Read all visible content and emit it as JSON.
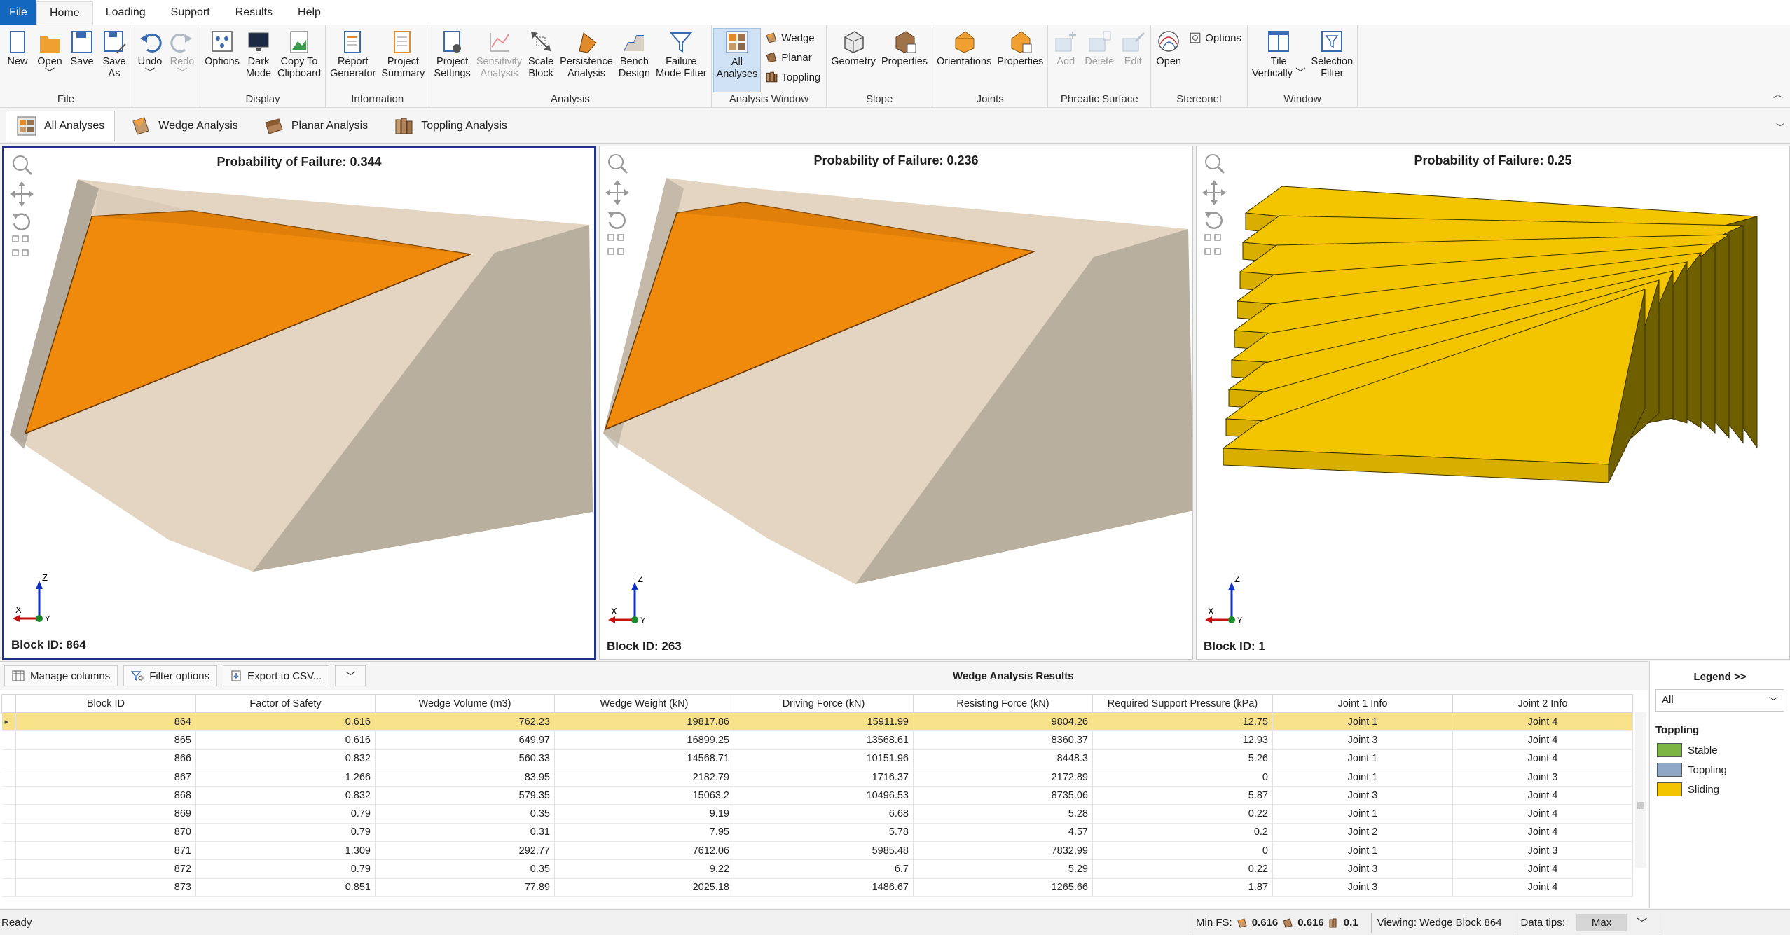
{
  "menu": [
    "File",
    "Home",
    "Loading",
    "Support",
    "Results",
    "Help"
  ],
  "ribbon": {
    "groups": [
      {
        "label": "File",
        "buttons": [
          {
            "label": "New",
            "icon": "new-file-icon"
          },
          {
            "label": "Open\n﹀",
            "icon": "open-folder-icon"
          },
          {
            "label": "Save",
            "icon": "save-icon"
          },
          {
            "label": "Save\nAs",
            "icon": "save-as-icon"
          }
        ]
      },
      {
        "label": "",
        "buttons": [
          {
            "label": "Undo\n﹀",
            "icon": "undo-icon"
          },
          {
            "label": "Redo\n﹀",
            "icon": "redo-icon",
            "disabled": true
          }
        ]
      },
      {
        "label": "Display",
        "buttons": [
          {
            "label": "Options",
            "icon": "options-icon"
          },
          {
            "label": "Dark\nMode",
            "icon": "dark-mode-icon"
          },
          {
            "label": "Copy To\nClipboard",
            "icon": "clipboard-icon"
          }
        ]
      },
      {
        "label": "Information",
        "buttons": [
          {
            "label": "Report\nGenerator",
            "icon": "report-icon"
          },
          {
            "label": "Project\nSummary",
            "icon": "summary-icon"
          }
        ]
      },
      {
        "label": "Analysis",
        "buttons": [
          {
            "label": "Project\nSettings",
            "icon": "settings-icon"
          },
          {
            "label": "Sensitivity\nAnalysis",
            "icon": "sensitivity-icon",
            "disabled": true
          },
          {
            "label": "Scale\nBlock",
            "icon": "scale-block-icon"
          },
          {
            "label": "Persistence\nAnalysis",
            "icon": "persistence-icon"
          },
          {
            "label": "Bench\nDesign",
            "icon": "bench-icon"
          },
          {
            "label": "Failure\nMode Filter",
            "icon": "filter-icon"
          }
        ]
      },
      {
        "label": "Analysis Window",
        "buttons": [
          {
            "label": "All\nAnalyses",
            "icon": "all-analyses-icon",
            "selected": true
          }
        ],
        "small": [
          "Wedge",
          "Planar",
          "Toppling"
        ]
      },
      {
        "label": "Slope",
        "buttons": [
          {
            "label": "Geometry",
            "icon": "geometry-icon"
          },
          {
            "label": "Properties",
            "icon": "properties-icon"
          }
        ]
      },
      {
        "label": "Joints",
        "buttons": [
          {
            "label": "Orientations",
            "icon": "orientations-icon"
          },
          {
            "label": "Properties",
            "icon": "joint-properties-icon"
          }
        ]
      },
      {
        "label": "Phreatic Surface",
        "buttons": [
          {
            "label": "Add",
            "icon": "add-icon",
            "disabled": true
          },
          {
            "label": "Delete",
            "icon": "delete-icon",
            "disabled": true
          },
          {
            "label": "Edit",
            "icon": "edit-icon",
            "disabled": true
          }
        ]
      },
      {
        "label": "Stereonet",
        "buttons": [
          {
            "label": "Open",
            "icon": "stereonet-icon"
          }
        ],
        "small": [
          "Options"
        ]
      },
      {
        "label": "Window",
        "buttons": [
          {
            "label": "Tile\nVertically ﹀",
            "icon": "tile-icon"
          },
          {
            "label": "Selection\nFilter",
            "icon": "selection-filter-icon"
          }
        ]
      }
    ]
  },
  "tabs": [
    "All Analyses",
    "Wedge Analysis",
    "Planar Analysis",
    "Toppling Analysis"
  ],
  "viewports": [
    {
      "title": "Probability of Failure: 0.344",
      "block": "Block ID: 864"
    },
    {
      "title": "Probability of Failure: 0.236",
      "block": "Block ID: 263"
    },
    {
      "title": "Probability of Failure: 0.25",
      "block": "Block ID: 1"
    }
  ],
  "axis_labels": {
    "z": "Z",
    "x": "X",
    "y": "Y"
  },
  "results": {
    "toolbar": {
      "manage": "Manage columns",
      "filter": "Filter options",
      "export": "Export to CSV..."
    },
    "title": "Wedge Analysis Results",
    "columns": [
      "Block ID",
      "Factor of Safety",
      "Wedge Volume (m3)",
      "Wedge Weight (kN)",
      "Driving Force (kN)",
      "Resisting Force (kN)",
      "Required Support Pressure (kPa)",
      "Joint 1 Info",
      "Joint 2 Info"
    ],
    "rows": [
      [
        "864",
        "0.616",
        "762.23",
        "19817.86",
        "15911.99",
        "9804.26",
        "12.75",
        "Joint 1",
        "Joint 4"
      ],
      [
        "865",
        "0.616",
        "649.97",
        "16899.25",
        "13568.61",
        "8360.37",
        "12.93",
        "Joint 3",
        "Joint 4"
      ],
      [
        "866",
        "0.832",
        "560.33",
        "14568.71",
        "10151.96",
        "8448.3",
        "5.26",
        "Joint 1",
        "Joint 4"
      ],
      [
        "867",
        "1.266",
        "83.95",
        "2182.79",
        "1716.37",
        "2172.89",
        "0",
        "Joint 1",
        "Joint 3"
      ],
      [
        "868",
        "0.832",
        "579.35",
        "15063.2",
        "10496.53",
        "8735.06",
        "5.87",
        "Joint 3",
        "Joint 4"
      ],
      [
        "869",
        "0.79",
        "0.35",
        "9.19",
        "6.68",
        "5.28",
        "0.22",
        "Joint 1",
        "Joint 4"
      ],
      [
        "870",
        "0.79",
        "0.31",
        "7.95",
        "5.78",
        "4.57",
        "0.2",
        "Joint 2",
        "Joint 4"
      ],
      [
        "871",
        "1.309",
        "292.77",
        "7612.06",
        "5985.48",
        "7832.99",
        "0",
        "Joint 1",
        "Joint 3"
      ],
      [
        "872",
        "0.79",
        "0.35",
        "9.22",
        "6.7",
        "5.29",
        "0.22",
        "Joint 3",
        "Joint 4"
      ],
      [
        "873",
        "0.851",
        "77.89",
        "2025.18",
        "1486.67",
        "1265.66",
        "1.87",
        "Joint 3",
        "Joint 4"
      ]
    ],
    "selected_row": 0
  },
  "legend": {
    "header": "Legend >>",
    "select": "All",
    "category": "Toppling",
    "items": [
      {
        "label": "Stable",
        "color": "#7db544"
      },
      {
        "label": "Toppling",
        "color": "#8fa8c8"
      },
      {
        "label": "Sliding",
        "color": "#f2c500"
      }
    ]
  },
  "status": {
    "ready": "Ready",
    "min_fs_label": "Min FS:",
    "val1": "0.616",
    "val2": "0.616",
    "val3": "0.1",
    "viewing": "Viewing: Wedge Block 864",
    "data_tips": "Data tips:",
    "max": "Max"
  },
  "colors": {
    "accent": "#1467bf",
    "wedge": "#f08a0c",
    "slope": "#e3d5c1",
    "sliding": "#f2c500",
    "selected_row": "#f7e28a",
    "active_frame": "#1f2f8c"
  }
}
